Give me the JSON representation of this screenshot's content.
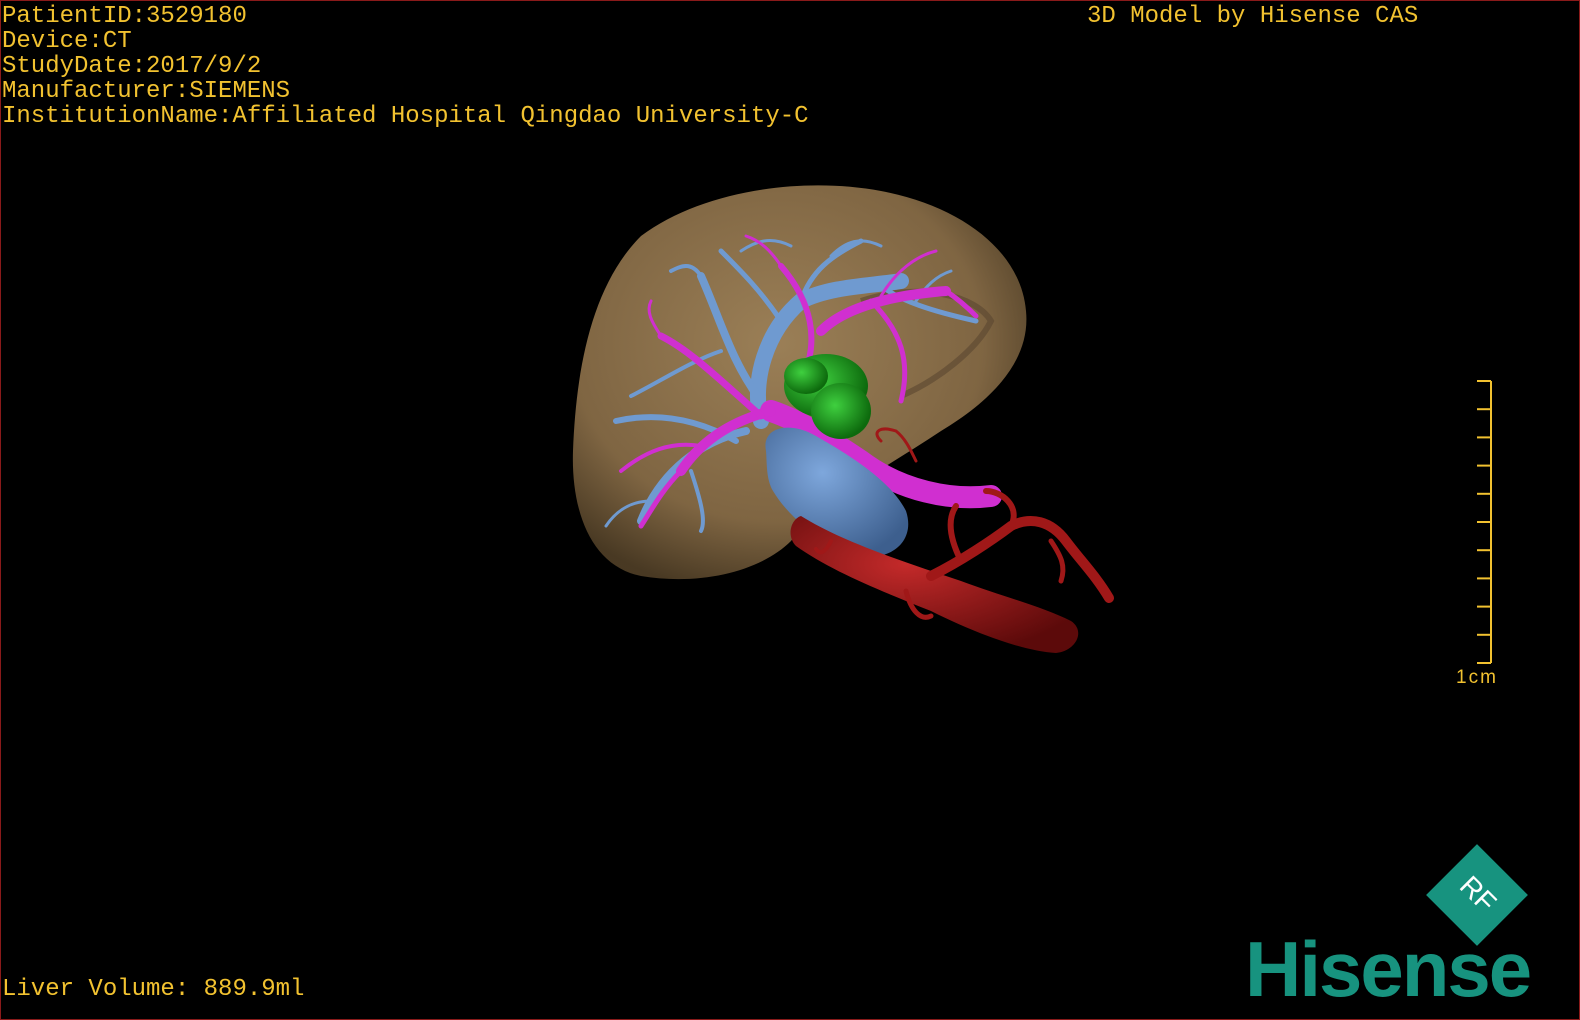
{
  "patient_info": {
    "patient_id": "PatientID:3529180",
    "device": "Device:CT",
    "study_date": "StudyDate:2017/9/2",
    "manufacturer": "Manufacturer:SIEMENS",
    "institution": "InstitutionName:Affiliated Hospital Qingdao University-C"
  },
  "model_credit": "3D Model by Hisense CAS",
  "liver_volume": "Liver Volume: 889.9ml",
  "scale": {
    "label": "1cm",
    "tick_count": 10
  },
  "brand": {
    "badge_letters": "RF",
    "wordmark": "Hisense",
    "color": "#17937f"
  },
  "colors": {
    "overlay_text": "#f2c230",
    "liver": "#8a6e48",
    "hepatic_vein": "#6f9ad0",
    "portal_vein": "#d02fd0",
    "artery": "#a01818",
    "tumor": "#1aa31a",
    "border": "#8a1a1a"
  }
}
